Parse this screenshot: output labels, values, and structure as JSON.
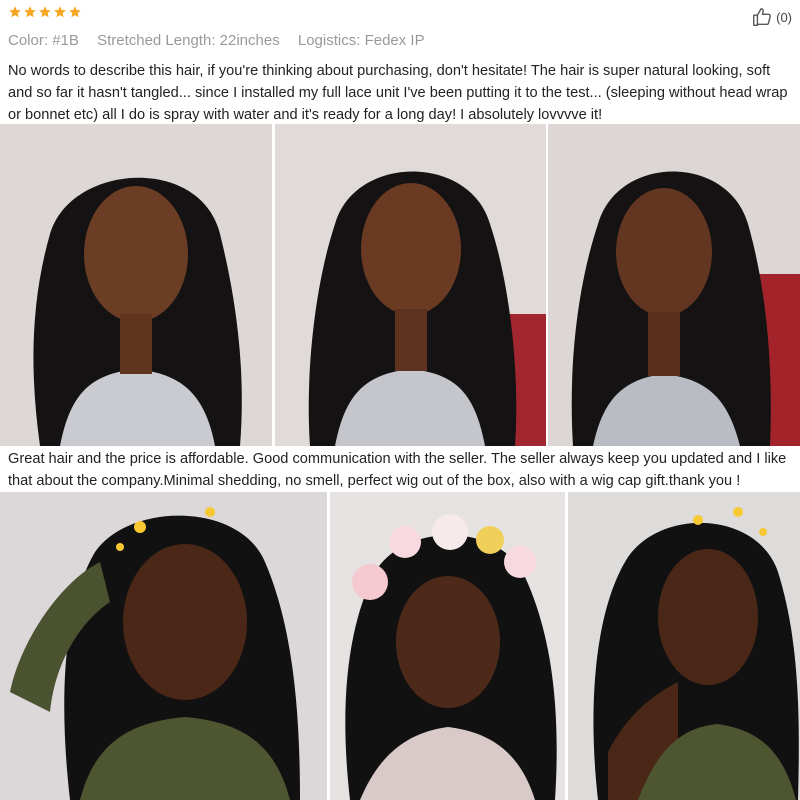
{
  "review": {
    "rating": 5,
    "stars_color": "#f5a623",
    "likes": "(0)",
    "meta": [
      {
        "label": "Color:",
        "value": "#1B"
      },
      {
        "label": "Stretched Length:",
        "value": "22inches"
      },
      {
        "label": "Logistics:",
        "value": "Fedex IP"
      }
    ]
  },
  "comments": {
    "first": "No words to describe this hair, if you're thinking about purchasing, don't hesitate! The hair is super natural looking, soft and so far it hasn't tangled... since I installed my full lace unit I've been putting it to the test... (sleeping without head wrap or bonnet etc) all I do is spray with water and it's ready for a long day! I absolutely lovvvve it!",
    "second": "Great hair and the price is affordable. Good communication with the seller. The seller always keep you updated and I like that about the company.Minimal shedding, no smell, perfect wig out of the box, also with a wig cap gift.thank you !"
  },
  "icons": {
    "star": "star-icon",
    "like": "thumbs-up-icon"
  }
}
